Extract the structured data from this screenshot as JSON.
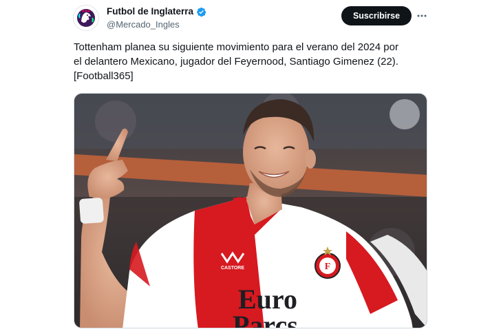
{
  "account": {
    "display_name": "Futbol de Inglaterra",
    "handle": "@Mercado_Ingles",
    "avatar_icon": "premier-league-lion-icon",
    "verified_icon": "verified-badge-icon",
    "verified_color": "#1d9bf0"
  },
  "actions": {
    "subscribe_label": "Suscribirse",
    "more_icon": "more-horizontal-icon"
  },
  "tweet": {
    "text": "Tottenham planea su siguiente movimiento para el verano del 2024 por\nel delantero Mexicano, jugador del Feyernood, Santiago Gimenez (22).\n[Football365]"
  },
  "media": {
    "jersey_brand": "CASTORE",
    "sponsor_line1": "Euro",
    "sponsor_line2": "Parcs",
    "jersey_colors": {
      "red": "#d71920",
      "white": "#ffffff"
    }
  },
  "colors": {
    "text_primary": "#0f1419",
    "text_secondary": "#536471",
    "button_bg": "#0f1419"
  }
}
